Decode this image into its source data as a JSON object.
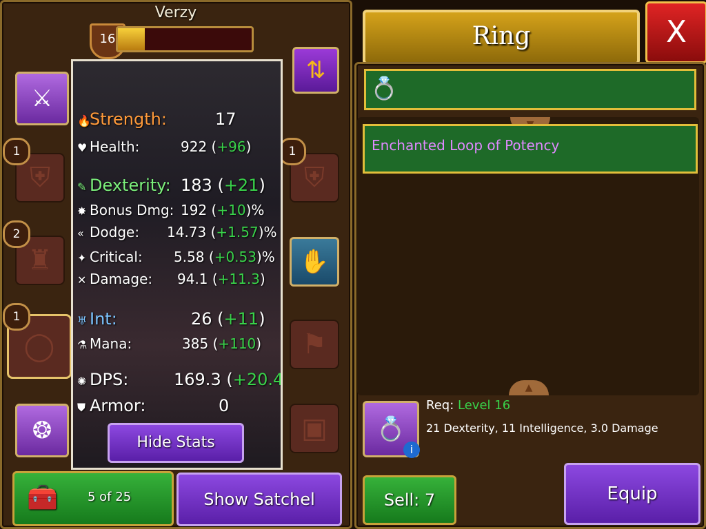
{
  "character": {
    "name": "Verzy",
    "level": "16",
    "xp_fraction": 0.2
  },
  "stats": [
    {
      "label": "Strength:",
      "value": "17",
      "gain": "",
      "suffix": "",
      "color": "#ff9a3a",
      "big": true
    },
    {
      "label": "Health:",
      "value": "922 (",
      "gain": "+96",
      "suffix": ")",
      "color": "#ffffff",
      "big": false
    },
    {
      "label": "Dexterity:",
      "value": "183 (",
      "gain": "+21",
      "suffix": ")",
      "color": "#7cf07c",
      "big": true
    },
    {
      "label": "Bonus Dmg:",
      "value": "192 (",
      "gain": "+10",
      "suffix": ")%",
      "color": "#ffffff",
      "big": false
    },
    {
      "label": "Dodge:",
      "value": "14.73 (",
      "gain": "+1.57",
      "suffix": ")%",
      "color": "#ffffff",
      "big": false
    },
    {
      "label": "Critical:",
      "value": "5.58 (",
      "gain": "+0.53",
      "suffix": ")%",
      "color": "#ffffff",
      "big": false
    },
    {
      "label": "Damage:",
      "value": "94.1 (",
      "gain": "+11.3",
      "suffix": ")",
      "color": "#ffffff",
      "big": false
    },
    {
      "label": "Int:",
      "value": "26 (",
      "gain": "+11",
      "suffix": ")",
      "color": "#7cc4ff",
      "big": true
    },
    {
      "label": "Mana:",
      "value": "385 (",
      "gain": "+110",
      "suffix": ")",
      "color": "#ffffff",
      "big": false
    },
    {
      "label": "DPS:",
      "value": "169.3 (",
      "gain": "+20.4",
      "suffix": ")",
      "color": "#ffffff",
      "big": true
    },
    {
      "label": "Armor:",
      "value": "0",
      "gain": "",
      "suffix": "",
      "color": "#ffffff",
      "big": true
    }
  ],
  "buttons": {
    "hide_stats": "Hide Stats",
    "show_satchel": "Show Satchel",
    "equip": "Equip",
    "sell": "Sell: 7"
  },
  "inventory": {
    "count": "5 of 25"
  },
  "slot_badges": {
    "left_helmet": "1",
    "left_chest": "2",
    "left_ring": "1",
    "right_helmet": "1"
  },
  "detail": {
    "title": "Ring",
    "close": "X",
    "item_name": "Enchanted Loop of Potency",
    "req_label": "Req:",
    "req_value": "Level 16",
    "item_stats": "21 Dexterity, 11 Intelligence, 3.0 Damage"
  },
  "colors": {
    "gain": "#39d24a",
    "item_name": "#e08aff",
    "req_value": "#39d24a",
    "accent": "#e2be3a"
  }
}
